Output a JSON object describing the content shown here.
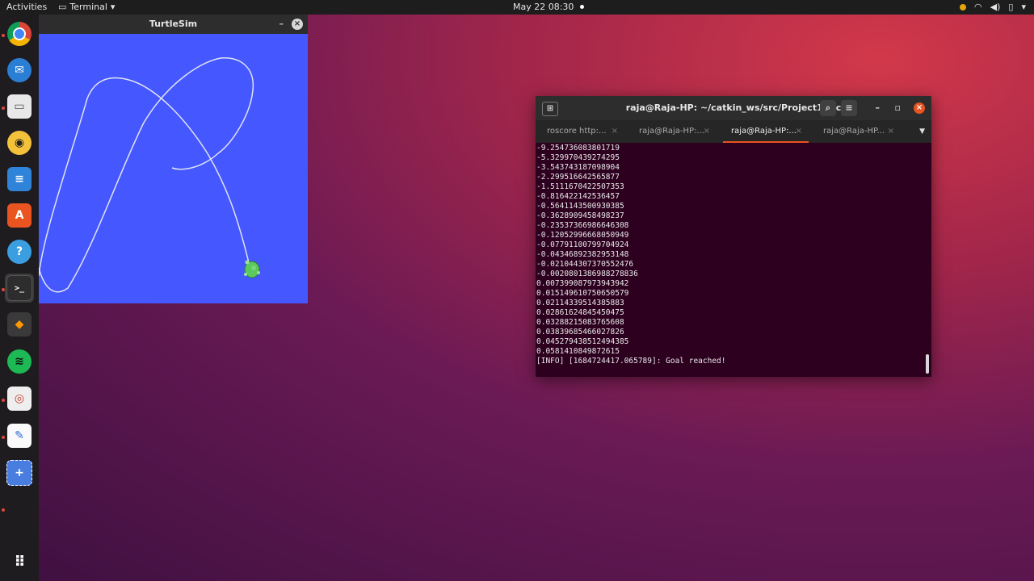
{
  "topbar": {
    "activities": "Activities",
    "app_menu": "Terminal",
    "clock": "May 22  08:30",
    "colors": {
      "indicator": "#e5a50a"
    }
  },
  "dock": {
    "items": [
      {
        "name": "chrome",
        "icon": "chrome-icon"
      },
      {
        "name": "thunderbird",
        "icon": "mail-icon"
      },
      {
        "name": "files",
        "icon": "folder-icon"
      },
      {
        "name": "rhythmbox",
        "icon": "music-icon"
      },
      {
        "name": "libreoffice-writer",
        "icon": "document-icon"
      },
      {
        "name": "software",
        "icon": "store-icon"
      },
      {
        "name": "help",
        "icon": "help-icon"
      },
      {
        "name": "terminal",
        "icon": "terminal-icon"
      },
      {
        "name": "sublime",
        "icon": "editor-icon"
      },
      {
        "name": "spotify",
        "icon": "spotify-icon"
      },
      {
        "name": "document-viewer",
        "icon": "viewer-icon"
      },
      {
        "name": "text-editor",
        "icon": "pencil-icon"
      },
      {
        "name": "screenshot",
        "icon": "screenshot-icon"
      }
    ],
    "show_apps_icon": "grid-icon"
  },
  "turtlesim": {
    "title": "TurtleSim",
    "minimize": "–",
    "close": "×",
    "colors": {
      "background": "#4557ff",
      "path": "#dfe3f5",
      "turtle": "#5cc95c"
    }
  },
  "terminal": {
    "title": "raja@Raja-HP: ~/catkin_ws/src/Project1/src",
    "tabs": [
      {
        "label": "roscore http:...",
        "active": false
      },
      {
        "label": "raja@Raja-HP:...",
        "active": false
      },
      {
        "label": "raja@Raja-HP:...",
        "active": true
      },
      {
        "label": "raja@Raja-HP...",
        "active": false
      }
    ],
    "tab_close": "×",
    "tab_menu": "▼",
    "lines": [
      "-9.254736083801719",
      "-5.329970439274295",
      "-3.543743187098904",
      "-2.299516642565877",
      "-1.5111670422507353",
      "-0.816422142536457",
      "-0.5641143500930385",
      "-0.3628909458498237",
      "-0.23537366986646308",
      "-0.12052996668050949",
      "-0.07791100799704924",
      "-0.04346892382953148",
      "-0.021044307370552476",
      "-0.0020801386988278836",
      "0.007399087973943942",
      "0.015149610750650579",
      "0.02114339514385883",
      "0.02861624845450475",
      "0.03288215083765608",
      "0.03839685466027826",
      "0.045279438512494385",
      "0.0581410849872615",
      "[INFO] [1684724417.065789]: Goal reached!"
    ],
    "colors": {
      "background": "#2c001e",
      "tab_accent": "#e95420"
    }
  }
}
